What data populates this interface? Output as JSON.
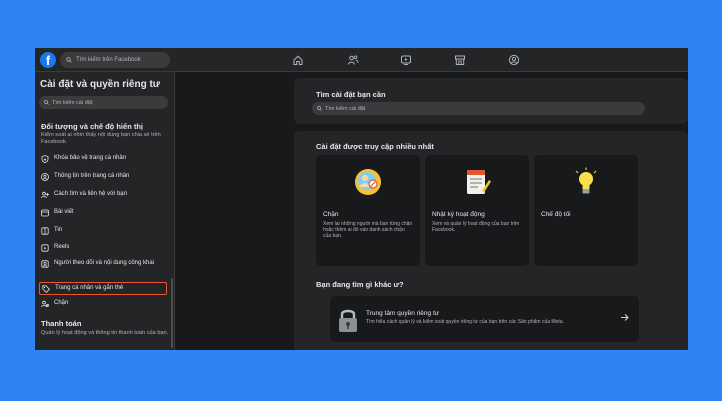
{
  "topbar": {
    "logo_letter": "f",
    "search_placeholder": "Tìm kiếm trên Facebook",
    "nav_icons": [
      "home-icon",
      "friends-icon",
      "watch-icon",
      "marketplace-icon",
      "groups-icon"
    ]
  },
  "sidebar": {
    "title": "Cài đặt và quyền riêng tư",
    "search_placeholder": "Tìm kiếm cài đặt",
    "section1": {
      "heading": "Đối tượng và chế độ hiển thị",
      "description": "Kiểm soát ai nhìn thấy nội dung bạn chia sẻ trên Facebook."
    },
    "items": [
      {
        "label": "Khóa bảo vệ trang cá nhân",
        "icon": "shield-lock-icon"
      },
      {
        "label": "Thông tin trên trang cá nhân",
        "icon": "profile-info-icon"
      },
      {
        "label": "Cách tìm và liên hệ với bạn",
        "icon": "find-contact-icon"
      },
      {
        "label": "Bài viết",
        "icon": "posts-icon"
      },
      {
        "label": "Tin",
        "icon": "stories-icon"
      },
      {
        "label": "Reels",
        "icon": "reels-icon"
      },
      {
        "label": "Người theo dõi và nội dung công khai",
        "icon": "followers-icon"
      },
      {
        "label": "Trang cá nhân và gắn thẻ",
        "icon": "tag-icon"
      },
      {
        "label": "Chặn",
        "icon": "block-user-icon"
      }
    ],
    "section2": {
      "heading": "Thanh toán",
      "description": "Quản lý hoạt động và thông tin thanh toán của bạn."
    }
  },
  "main": {
    "search_card": {
      "title": "Tìm cài đặt bạn cần",
      "placeholder": "Tìm kiếm cài đặt"
    },
    "frequent": {
      "title": "Cài đặt được truy cập nhiều nhất",
      "tiles": [
        {
          "title": "Chặn",
          "description": "Xem lại những người mà bạn từng chặn hoặc thêm ai đó vào danh sách chặn của bạn."
        },
        {
          "title": "Nhật ký hoạt động",
          "description": "Xem và quản lý hoạt động của bạn trên Facebook."
        },
        {
          "title": "Chế độ tối",
          "description": ""
        }
      ]
    },
    "other": {
      "question": "Bạn đang tìm gì khác ư?",
      "privacy_center_title": "Trung tâm quyền riêng tư",
      "privacy_center_desc": "Tìm hiểu cách quản lý và kiểm soát quyền riêng tư của bạn trên các Sản phẩm của Meta."
    }
  },
  "colors": {
    "background": "#2f84f3",
    "app_bg": "#18191a",
    "panel": "#242526",
    "highlight_border": "#f0522d",
    "brand": "#1877f2"
  }
}
